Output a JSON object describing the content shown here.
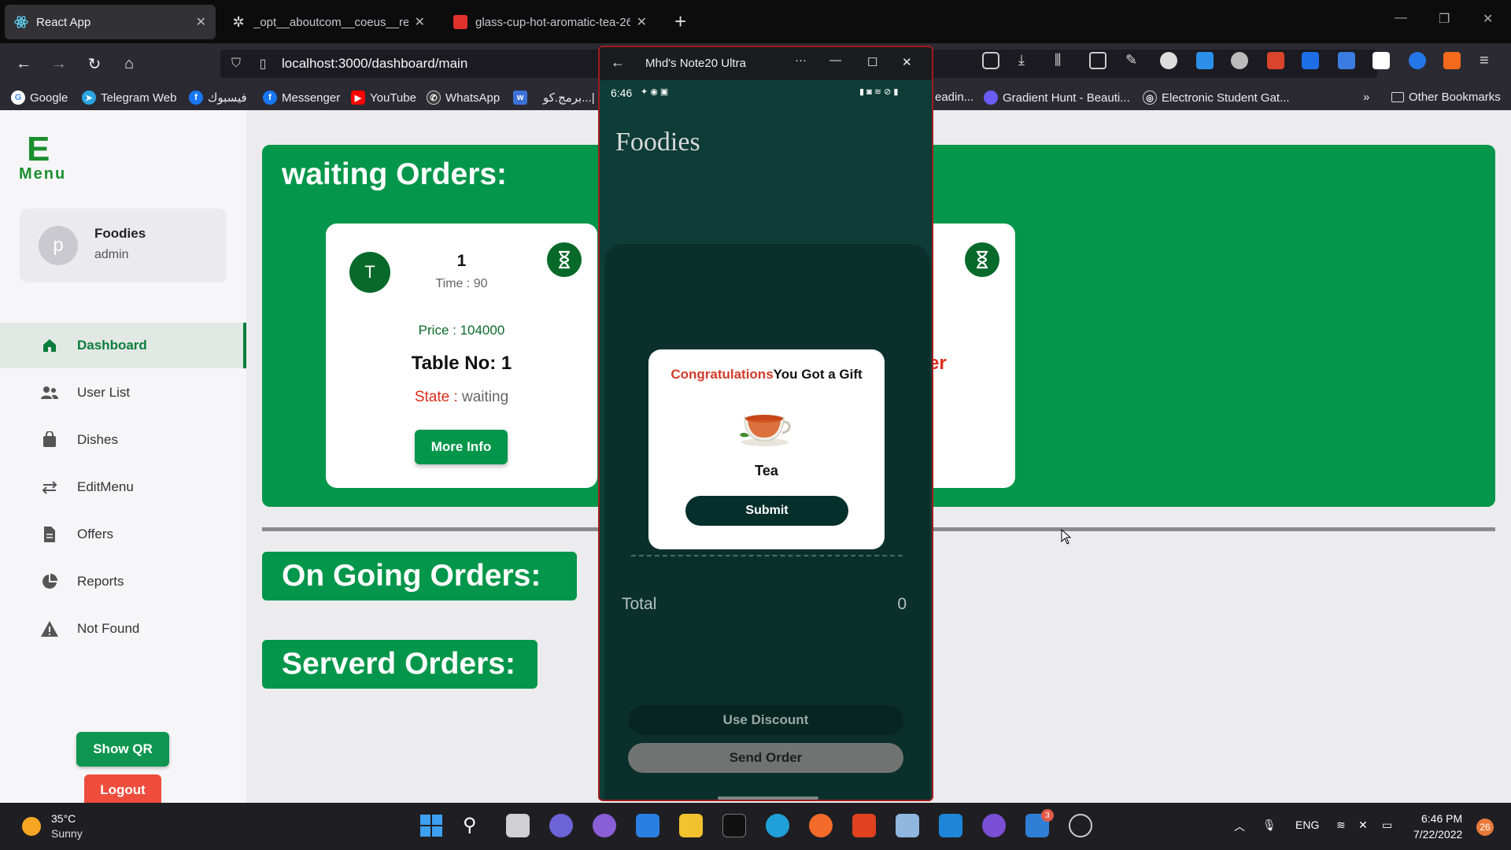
{
  "browser": {
    "tabs": [
      {
        "label": "React App",
        "active": true
      },
      {
        "label": "_opt__aboutcom__coeus__reso",
        "active": false
      },
      {
        "label": "glass-cup-hot-aromatic-tea-26",
        "active": false
      }
    ],
    "url": "localhost:3000/dashboard/main",
    "bookmarks": [
      "Google",
      "Telegram Web",
      "فيسبوك",
      "Messenger",
      "YouTube",
      "WhatsApp",
      "برمج.كو...|",
      "eadin...",
      "Gradient Hunt - Beauti...",
      "Electronic Student Gat..."
    ],
    "other_bookmarks": "Other Bookmarks"
  },
  "sidebar": {
    "logo_letter": "E",
    "logo_text": "Menu",
    "profile": {
      "initial": "p",
      "name": "Foodies",
      "role": "admin"
    },
    "items": [
      {
        "label": "Dashboard",
        "icon": "home-icon",
        "active": true
      },
      {
        "label": "User List",
        "icon": "users-icon",
        "active": false
      },
      {
        "label": "Dishes",
        "icon": "bag-icon",
        "active": false
      },
      {
        "label": "EditMenu",
        "icon": "swap-icon",
        "active": false
      },
      {
        "label": "Offers",
        "icon": "document-icon",
        "active": false
      },
      {
        "label": "Reports",
        "icon": "pie-chart-icon",
        "active": false
      },
      {
        "label": "Not Found",
        "icon": "warning-icon",
        "active": false
      }
    ],
    "show_qr": "Show QR",
    "logout": "Logout"
  },
  "main": {
    "waiting_title": "waiting Orders:",
    "order": {
      "avatar_initial": "T",
      "number": "1",
      "time": "Time : 90",
      "price": "Price : 104000",
      "table": "Table No: 1",
      "state_label": "State :",
      "state_value": "waiting",
      "more_info": "More Info"
    },
    "second_card_partial": "er",
    "ongoing_title": "On Going Orders:",
    "served_title": "Serverd Orders:"
  },
  "phone": {
    "window_title": "Mhd's Note20 Ultra",
    "status_time": "6:46",
    "app_title": "Foodies",
    "modal": {
      "congrats": "Congratulations",
      "rest": "You Got a Gift",
      "item": "Tea",
      "submit": "Submit"
    },
    "total_label": "Total",
    "total_value": "0",
    "use_discount": "Use Discount",
    "send_order": "Send Order"
  },
  "taskbar": {
    "temp": "35°C",
    "weather": "Sunny",
    "lang": "ENG",
    "time": "6:46 PM",
    "date": "7/22/2022",
    "notifications": "26",
    "badge": "3"
  },
  "colors": {
    "brand_green": "#04964a",
    "dark_green": "#07692a",
    "logout_red": "#ee4c3d",
    "phone_bg": "#0d3d36"
  }
}
